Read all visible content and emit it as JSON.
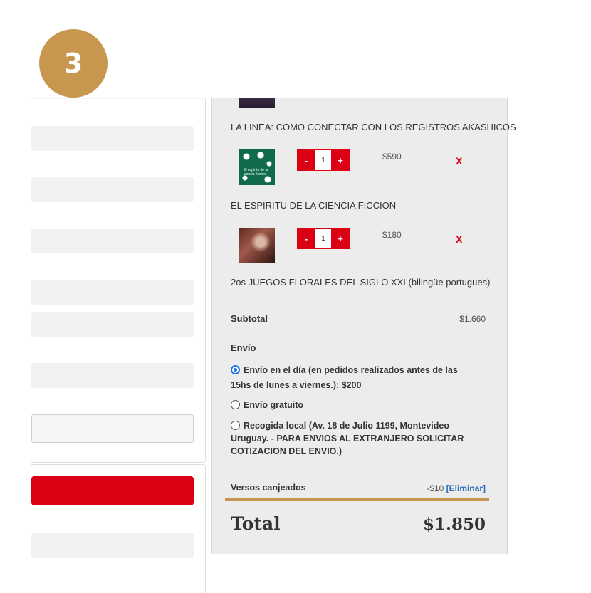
{
  "step": {
    "number": "3"
  },
  "cart": {
    "items": [
      {
        "title": "LA LINEA: COMO CONECTAR CON LOS REGISTROS AKASHICOS"
      },
      {
        "thumb_text": "El espíritu de la ciencia ficción",
        "qty": "1",
        "price": "$590",
        "remove": "X",
        "title": "EL ESPIRITU DE LA CIENCIA FICCION",
        "qty_minus": "-",
        "qty_plus": "+"
      },
      {
        "qty": "1",
        "price": "$180",
        "remove": "X",
        "title": "2os JUEGOS FLORALES DEL SIGLO XXI (bilingüe portugues)",
        "qty_minus": "-",
        "qty_plus": "+"
      }
    ]
  },
  "summary": {
    "subtotal_label": "Subtotal",
    "subtotal_value": "$1.660",
    "shipping_label": "Envío",
    "shipping_options": [
      {
        "label": "Envío en el día (en pedidos realizados antes de las 15hs de lunes a viernes.): $200",
        "selected": true
      },
      {
        "label": "Envío gratuito",
        "selected": false
      },
      {
        "label": "Recogida local (Av. 18 de Julio 1199, Montevideo Uruguay. - PARA ENVIOS AL EXTRANJERO SOLICITAR COTIZACION DEL ENVIO.)",
        "selected": false
      }
    ],
    "coupon_label": "Versos canjeados",
    "coupon_value": "-$10",
    "coupon_remove": "[Eliminar]",
    "total_label": "Total",
    "total_value": "$1.850"
  },
  "colors": {
    "accent_gold": "#c8974f",
    "brand_red": "#dc0014",
    "radio_blue": "#1a73e8",
    "link_blue": "#2a6fb5"
  }
}
